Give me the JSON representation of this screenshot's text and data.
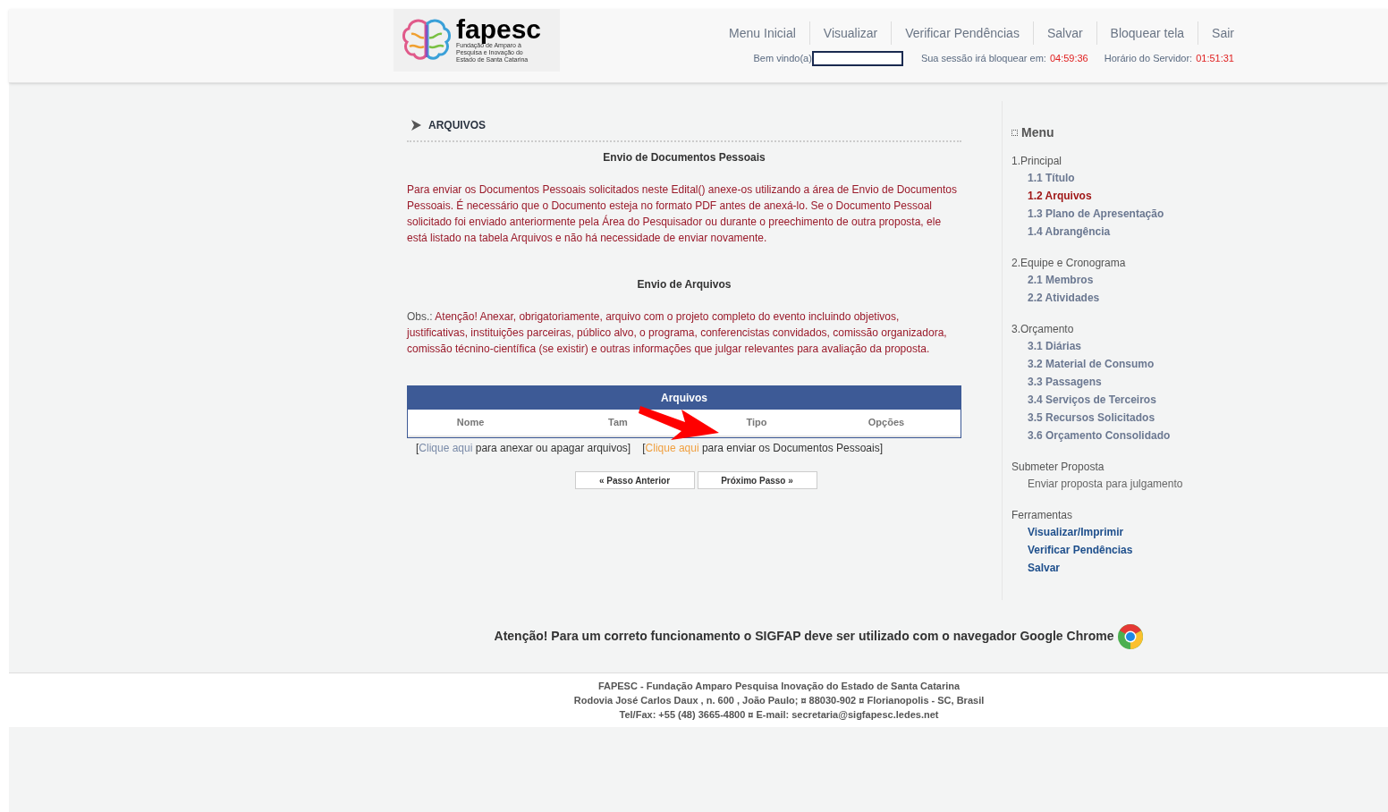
{
  "header": {
    "logo": {
      "name": "fapesc",
      "tagline": [
        "Fundação de Amparo à",
        "Pesquisa e Inovação do",
        "Estado de Santa Catarina"
      ]
    },
    "nav": [
      "Menu Inicial",
      "Visualizar",
      "Verificar Pendências",
      "Salvar",
      "Bloquear tela",
      "Sair"
    ],
    "welcome": {
      "label": "Bem vindo(a)"
    },
    "session": {
      "label": "Sua sessão irá bloquear em:",
      "value": "04:59:36"
    },
    "server_time": {
      "label": "Horário do Servidor:",
      "value": "01:51:31"
    }
  },
  "main": {
    "section_title": "ARQUIVOS",
    "personal_docs": {
      "heading": "Envio de Documentos Pessoais",
      "text": "Para enviar os Documentos Pessoais solicitados neste Edital() anexe-os utilizando a área de Envio de Documentos Pessoais. É necessário que o Documento esteja no formato PDF antes de anexá-lo. Se o Documento Pessoal solicitado foi enviado anteriormente pela Área do Pesquisador ou durante o preechimento de outra proposta, ele está listado na tabela Arquivos e não há necessidade de enviar novamente."
    },
    "files": {
      "heading": "Envio de Arquivos",
      "obs_label": "Obs.:",
      "obs_text": "Atenção! Anexar, obrigatoriamente, arquivo com o projeto completo do evento incluindo objetivos, justificativas, instituições parceiras, público alvo, o programa, conferencistas convidados, comissão organizadora, comissão técnino-científica (se existir) e outras informações que julgar relevantes para avaliação da proposta."
    },
    "table": {
      "title": "Arquivos",
      "columns": [
        "Nome",
        "Tam",
        "Tipo",
        "Opções"
      ]
    },
    "links": [
      {
        "open": "[",
        "link": "Clique aqui",
        "text": "para anexar ou apagar arquivos",
        "close": "]",
        "color": "#7a8ba8"
      },
      {
        "open": "[",
        "link": "Clique aqui",
        "text": "para enviar os Documentos Pessoais",
        "close": "]",
        "color": "#f0a040"
      }
    ],
    "buttons": [
      "« Passo Anterior",
      "Próximo Passo »"
    ]
  },
  "sidebar": {
    "title": "Menu",
    "groups": [
      {
        "label": "1.Principal",
        "items": [
          {
            "label": "1.1 Título",
            "kind": "step",
            "selected": false
          },
          {
            "label": "1.2 Arquivos",
            "kind": "step",
            "selected": true
          },
          {
            "label": "1.3 Plano de Apresentação",
            "kind": "step",
            "selected": false
          },
          {
            "label": "1.4 Abrangência",
            "kind": "step",
            "selected": false
          }
        ]
      },
      {
        "label": "2.Equipe e Cronograma",
        "items": [
          {
            "label": "2.1 Membros",
            "kind": "step",
            "selected": false
          },
          {
            "label": "2.2 Atividades",
            "kind": "step",
            "selected": false
          }
        ]
      },
      {
        "label": "3.Orçamento",
        "items": [
          {
            "label": "3.1 Diárias",
            "kind": "step",
            "selected": false
          },
          {
            "label": "3.2 Material de Consumo",
            "kind": "step",
            "selected": false
          },
          {
            "label": "3.3 Passagens",
            "kind": "step",
            "selected": false
          },
          {
            "label": "3.4 Serviços de Terceiros",
            "kind": "step",
            "selected": false
          },
          {
            "label": "3.5 Recursos Solicitados",
            "kind": "step",
            "selected": false
          },
          {
            "label": "3.6 Orçamento Consolidado",
            "kind": "step",
            "selected": false
          }
        ]
      },
      {
        "label": "Submeter Proposta",
        "items": [
          {
            "label": "Enviar proposta para julgamento",
            "kind": "action",
            "selected": false
          }
        ]
      },
      {
        "label": "Ferramentas",
        "items": [
          {
            "label": "Visualizar/Imprimir",
            "kind": "tool",
            "selected": false
          },
          {
            "label": "Verificar Pendências",
            "kind": "tool",
            "selected": false
          },
          {
            "label": "Salvar",
            "kind": "tool",
            "selected": false
          }
        ]
      }
    ]
  },
  "browser_notice": "Atenção! Para um correto funcionamento o SIGFAP deve ser utilizado com o navegador Google Chrome",
  "footer": [
    "FAPESC - Fundação Amparo Pesquisa Inovação do Estado de Santa Catarina",
    "Rodovia José Carlos Daux , n. 600 , João Paulo; ¤ 88030-902 ¤ Florianopolis - SC, Brasil",
    "Tel/Fax: +55 (48) 3665-4800 ¤ E-mail: secretaria@sigfapesc.ledes.net"
  ]
}
